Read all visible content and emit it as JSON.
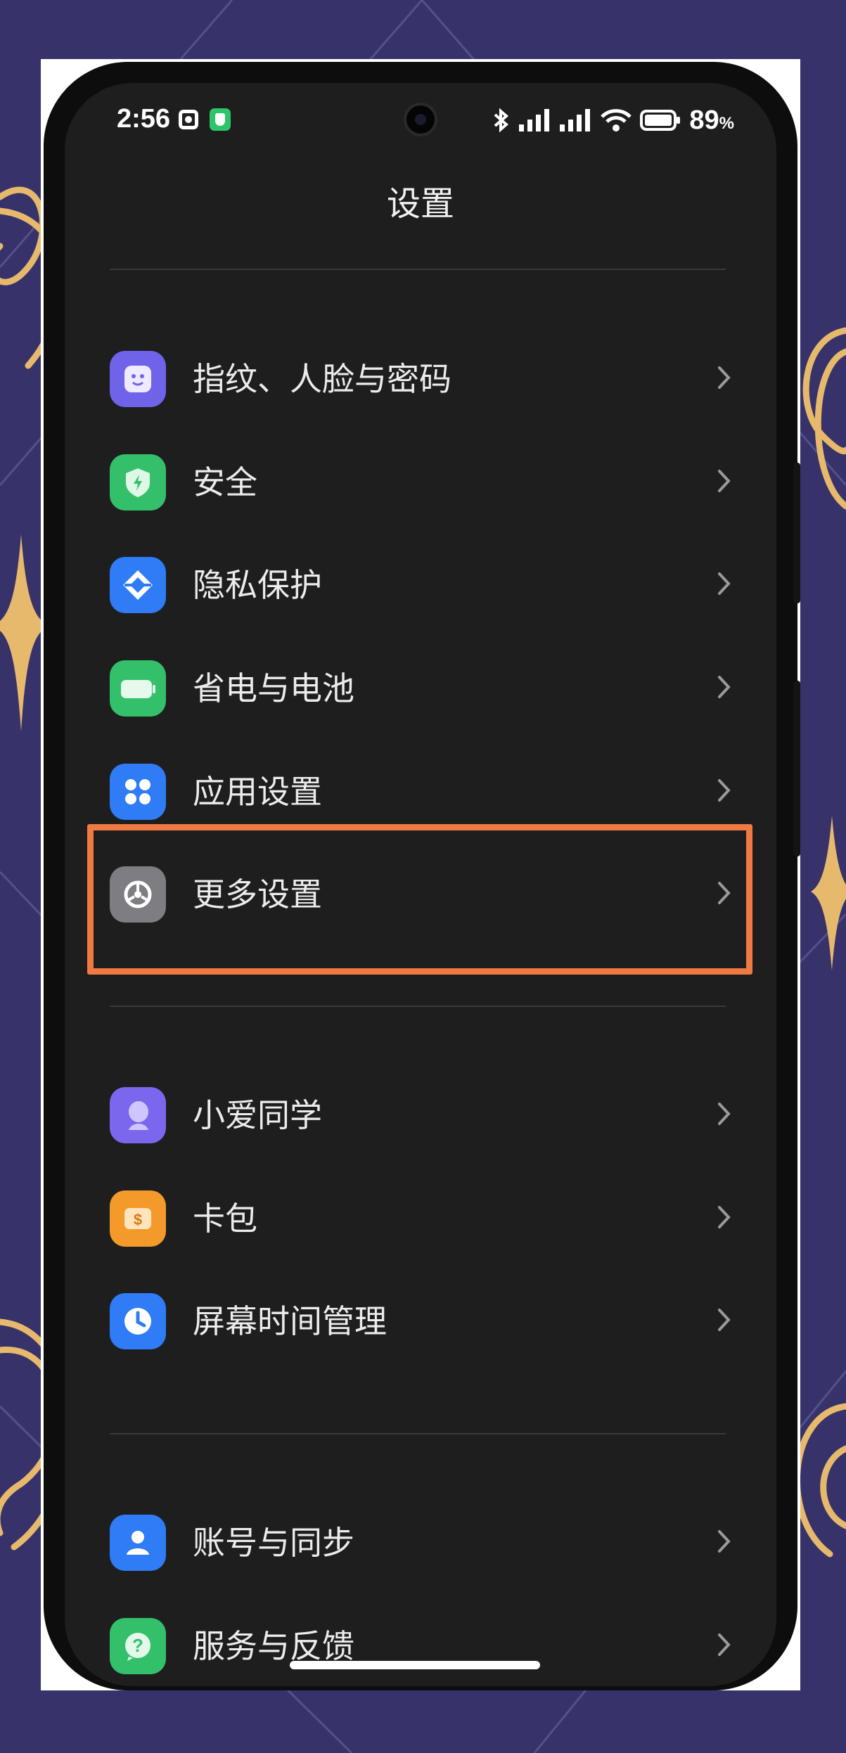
{
  "status_bar": {
    "time": "2:56",
    "battery": "89",
    "battery_unit": "%"
  },
  "page": {
    "title": "设置"
  },
  "groups": [
    [
      {
        "label": "指纹、人脸与密码",
        "icon": "face-id-icon",
        "color": "#6f63ea"
      },
      {
        "label": "安全",
        "icon": "shield-icon",
        "color": "#34c06a"
      },
      {
        "label": "隐私保护",
        "icon": "privacy-icon",
        "color": "#2f7cf6"
      },
      {
        "label": "省电与电池",
        "icon": "battery-icon",
        "color": "#34c06a"
      },
      {
        "label": "应用设置",
        "icon": "apps-grid-icon",
        "color": "#2f7cf6"
      },
      {
        "label": "更多设置",
        "icon": "gear-icon",
        "color": "#8a8a8e"
      }
    ],
    [
      {
        "label": "小爱同学",
        "icon": "assistant-icon",
        "color": "#7b66ee"
      },
      {
        "label": "卡包",
        "icon": "wallet-icon",
        "color": "#f39a2b"
      },
      {
        "label": "屏幕时间管理",
        "icon": "clock-icon",
        "color": "#2f7cf6"
      }
    ],
    [
      {
        "label": "账号与同步",
        "icon": "account-icon",
        "color": "#2f7cf6"
      },
      {
        "label": "服务与反馈",
        "icon": "help-icon",
        "color": "#34c06a"
      }
    ]
  ],
  "highlighted_item": "更多设置",
  "colors": {
    "highlight": "#f07a42",
    "background": "#37336a",
    "screen": "#1e1e1f"
  }
}
